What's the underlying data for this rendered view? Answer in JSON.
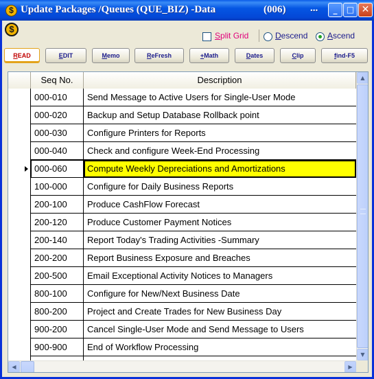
{
  "window": {
    "title": "Update Packages /Queues  (QUE_BIZ)  -Data",
    "code": "(006)",
    "dots": "...",
    "app_icon_glyph": "$",
    "controls": {
      "minimize": "_",
      "maximize": "□",
      "close": "✕"
    }
  },
  "toolbar": {
    "coin_glyph": "$",
    "split_grid": {
      "label_prefix": "",
      "label_underlined": "S",
      "label_rest": "plit Grid",
      "checked": false
    },
    "sort": {
      "descend": {
        "underlined": "D",
        "rest": "escend",
        "selected": false
      },
      "ascend": {
        "underlined": "A",
        "rest": "scend",
        "selected": true
      }
    },
    "buttons": [
      {
        "u": "R",
        "rest": "EAD",
        "active": true
      },
      {
        "u": "E",
        "rest": "DIT",
        "active": false
      },
      {
        "u": "M",
        "rest": "emo",
        "active": false
      },
      {
        "u": "R",
        "rest": "eFresh",
        "active": false
      },
      {
        "u": "+",
        "rest": "Math",
        "active": false
      },
      {
        "u": "D",
        "rest": "ates",
        "active": false
      },
      {
        "u": "C",
        "rest": "lip",
        "active": false
      },
      {
        "u": "f",
        "rest": "ind-F5",
        "active": false
      }
    ]
  },
  "grid": {
    "columns": [
      "Seq No.",
      "Description"
    ],
    "selected_index": 4,
    "rows": [
      {
        "seq": "000-010",
        "desc": "Send Message to Active Users for Single-User Mode"
      },
      {
        "seq": "000-020",
        "desc": "Backup and Setup Database Rollback point"
      },
      {
        "seq": "000-030",
        "desc": "Configure Printers for Reports"
      },
      {
        "seq": "000-040",
        "desc": "Check and configure Week-End Processing"
      },
      {
        "seq": "000-060",
        "desc": "Compute Weekly Depreciations and Amortizations"
      },
      {
        "seq": "100-000",
        "desc": "Configure for Daily Business Reports"
      },
      {
        "seq": "200-100",
        "desc": "Produce CashFlow Forecast"
      },
      {
        "seq": "200-120",
        "desc": "Produce Customer Payment Notices"
      },
      {
        "seq": "200-140",
        "desc": "Report Today's Trading Activities -Summary"
      },
      {
        "seq": "200-200",
        "desc": "Report Business Exposure and Breaches"
      },
      {
        "seq": "200-500",
        "desc": "Email Exceptional Activity Notices to Managers"
      },
      {
        "seq": "800-100",
        "desc": "Configure for New/Next Business Date"
      },
      {
        "seq": "800-200",
        "desc": "Project and Create Trades for New Business Day"
      },
      {
        "seq": "900-200",
        "desc": "Cancel Single-User Mode and Send Message to Users"
      },
      {
        "seq": "900-900",
        "desc": "End of Workflow Processing"
      },
      {
        "seq": "",
        "desc": ""
      }
    ]
  },
  "colors": {
    "titlebar": "#0556e3",
    "selection": "#ffff00",
    "split_grid_text": "#e0007a",
    "active_tab_accent": "#e3a21a"
  }
}
